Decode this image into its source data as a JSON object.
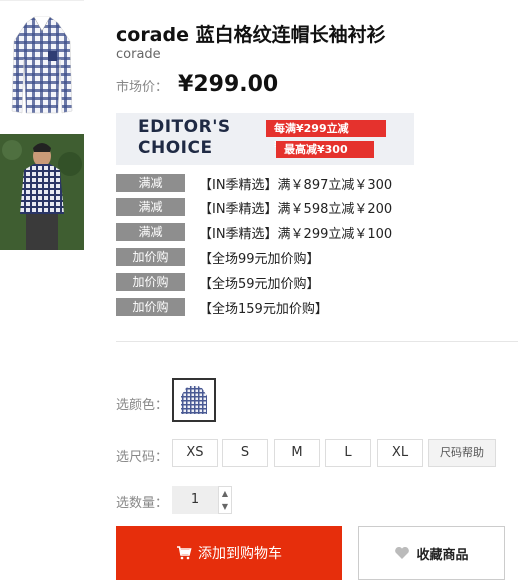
{
  "product": {
    "title": "corade 蓝白格纹连帽长袖衬衫",
    "brand": "corade",
    "price_label": "市场价：",
    "price": "¥299.00"
  },
  "banner": {
    "line1": "EDITOR'S",
    "line2": "CHOICE",
    "tag1": "每满¥299立减¥100",
    "tag2": "最高减¥300"
  },
  "promos": [
    {
      "badge": "满减",
      "text": "【IN季精选】满￥897立减￥300"
    },
    {
      "badge": "满减",
      "text": "【IN季精选】满￥598立减￥200"
    },
    {
      "badge": "满减",
      "text": "【IN季精选】满￥299立减￥100"
    },
    {
      "badge": "加价购",
      "text": "【全场99元加价购】"
    },
    {
      "badge": "加价购",
      "text": "【全场59元加价购】"
    },
    {
      "badge": "加价购",
      "text": "【全场159元加价购】"
    }
  ],
  "options": {
    "color_label": "选颜色：",
    "size_label": "选尺码：",
    "sizes": [
      "XS",
      "S",
      "M",
      "L",
      "XL"
    ],
    "size_help": "尺码帮助",
    "qty_label": "选数量：",
    "qty_value": "1"
  },
  "actions": {
    "add_to_cart": "添加到购物车",
    "favorite": "收藏商品"
  },
  "colors": {
    "accent": "#e62e0c",
    "badge": "#8e8e8e"
  }
}
